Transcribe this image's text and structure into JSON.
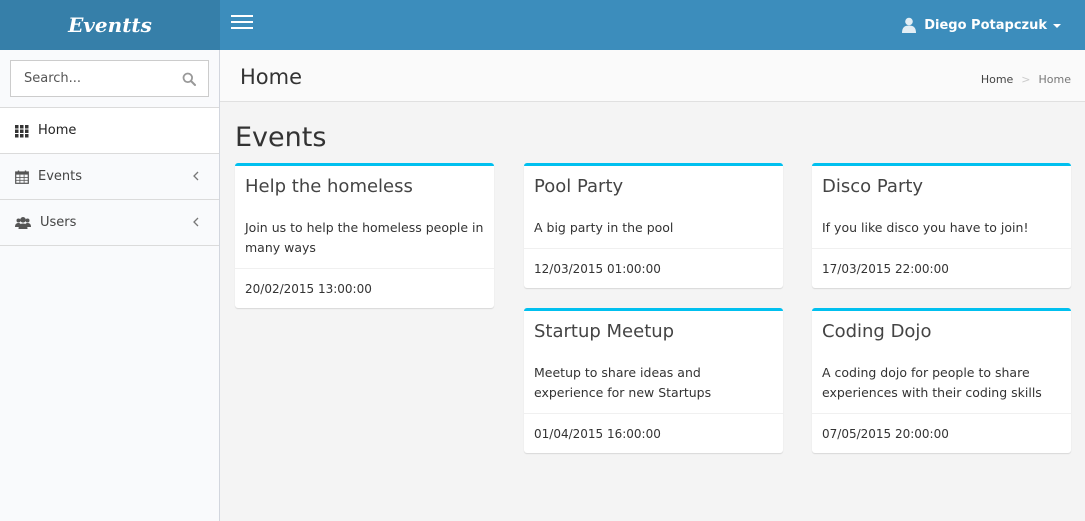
{
  "app": {
    "logo_text": "Eventts"
  },
  "header": {
    "user_name": "Diego Potapczuk"
  },
  "sidebar": {
    "search_placeholder": "Search...",
    "items": [
      {
        "label": "Home",
        "icon": "grid-icon",
        "active": true
      },
      {
        "label": "Events",
        "icon": "calendar-icon",
        "active": false
      },
      {
        "label": "Users",
        "icon": "users-icon",
        "active": false
      }
    ]
  },
  "content_header": {
    "title": "Home",
    "breadcrumb": [
      "Home",
      "Home"
    ]
  },
  "main": {
    "section_title": "Events",
    "events": [
      {
        "title": "Help the homeless",
        "description": "Join us to help the homeless people in many ways",
        "date": "20/02/2015 13:00:00"
      },
      {
        "title": "Pool Party",
        "description": "A big party in the pool",
        "date": "12/03/2015 01:00:00"
      },
      {
        "title": "Disco Party",
        "description": "If you like disco you have to join!",
        "date": "17/03/2015 22:00:00"
      },
      {
        "title": "Startup Meetup",
        "description": "Meetup to share ideas and experience for new Startups",
        "date": "01/04/2015 16:00:00"
      },
      {
        "title": "Coding Dojo",
        "description": "A coding dojo for people to share experiences with their coding skills",
        "date": "07/05/2015 20:00:00"
      }
    ]
  },
  "colors": {
    "header": "#3c8dbc",
    "logo_bg": "#367fa9",
    "card_accent": "#00c0ef"
  }
}
